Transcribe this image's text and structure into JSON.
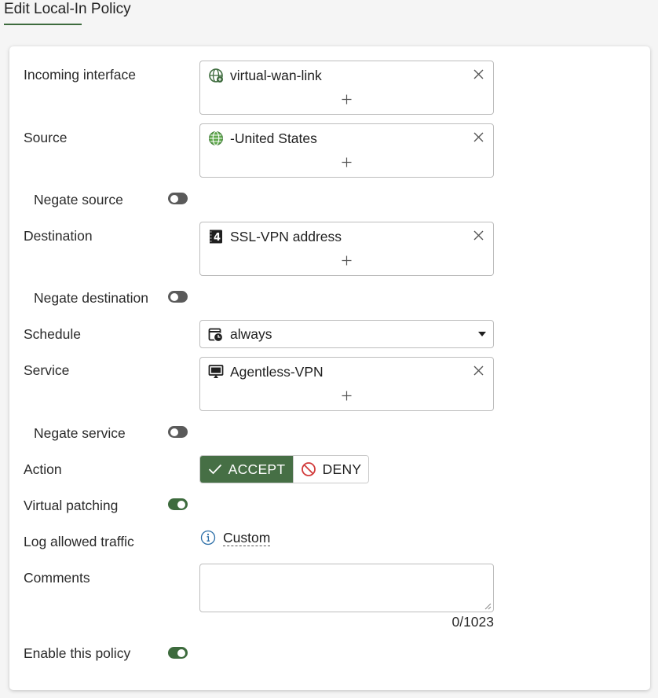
{
  "page": {
    "title": "Edit Local-In Policy"
  },
  "fields": {
    "incoming_interface": {
      "label": "Incoming interface",
      "value": "virtual-wan-link",
      "icon": "sd-wan-globe-icon"
    },
    "source": {
      "label": "Source",
      "value": "-United States",
      "icon": "geography-globe-icon"
    },
    "negate_source": {
      "label": "Negate source",
      "enabled": false
    },
    "destination": {
      "label": "Destination",
      "value": "SSL-VPN address",
      "icon": "ipv4-address-icon",
      "icon_glyph": "4"
    },
    "negate_destination": {
      "label": "Negate destination",
      "enabled": false
    },
    "schedule": {
      "label": "Schedule",
      "value": "always",
      "icon": "schedule-clock-icon"
    },
    "service": {
      "label": "Service",
      "value": "Agentless-VPN",
      "icon": "monitor-service-icon"
    },
    "negate_service": {
      "label": "Negate service",
      "enabled": false
    },
    "action": {
      "label": "Action",
      "options": [
        "ACCEPT",
        "DENY"
      ],
      "selected": "ACCEPT"
    },
    "virtual_patching": {
      "label": "Virtual patching",
      "enabled": true
    },
    "log_allowed_traffic": {
      "label": "Log allowed traffic",
      "value": "Custom"
    },
    "comments": {
      "label": "Comments",
      "value": "",
      "counter": "0/1023"
    },
    "enable_policy": {
      "label": "Enable this policy",
      "enabled": true
    }
  },
  "colors": {
    "accent_green": "#466f45",
    "toggle_off": "#5a5a5a",
    "deny_red": "#d23b3b",
    "info_blue": "#2d6fa8"
  }
}
